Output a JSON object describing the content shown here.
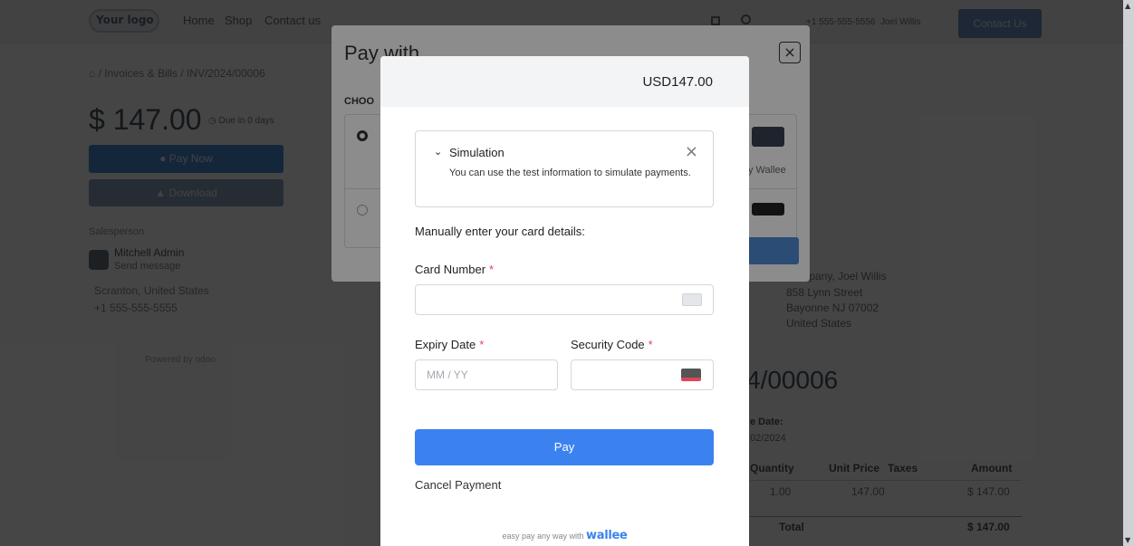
{
  "background": {
    "nav": {
      "logo_text": "Your logo",
      "links": [
        "Home",
        "Shop",
        "Contact us"
      ],
      "phone": "+1 555-555-5556",
      "user": "Joel Willis",
      "contact_button": "Contact Us"
    },
    "breadcrumb": "/ Invoices & Bills / INV/2024/00006",
    "amount": "$ 147.00",
    "due_badge": "Due in 0 days",
    "pay_now": "Pay Now",
    "download": "Download",
    "salesperson_label": "Salesperson",
    "salesperson_name": "Mitchell Admin",
    "send_message": "Send message",
    "location": "Scranton, United States",
    "phone": "+1 555-555-5555",
    "powered_by": "Powered by odoo",
    "address_lines": [
      "Company, Joel Willis",
      "858 Lynn Street",
      "Bayonne NJ 07002",
      "United States"
    ],
    "invoice_number_partial": "4/00006",
    "due_date_label": "e Date:",
    "due_date_value": "02/2024",
    "table_headers": [
      "Quantity",
      "Unit Price",
      "Taxes",
      "Amount"
    ],
    "row": {
      "quantity": "1.00",
      "unit_price": "147.00",
      "amount": "$ 147.00"
    },
    "total_label": "Total",
    "total_value": "$ 147.00"
  },
  "paywith": {
    "title": "Pay with",
    "close": "×",
    "choose_label": "CHOO",
    "wallee_caption": "y Wallee"
  },
  "wallee": {
    "header_amount": "USD147.00",
    "simulation": {
      "title": "Simulation",
      "text": "You can use the test information to simulate payments.",
      "close": "×"
    },
    "manual_label": "Manually enter your card details:",
    "card_number_label": "Card Number",
    "card_number_placeholder": "",
    "expiry_label": "Expiry Date",
    "expiry_placeholder": "MM / YY",
    "security_label": "Security Code",
    "security_placeholder": "",
    "required_mark": "*",
    "pay_button": "Pay",
    "cancel": "Cancel Payment",
    "footer_text": "easy pay any way with",
    "footer_brand": "wallee"
  },
  "colors": {
    "pay_blue": "#3b82f0",
    "required_red": "#e0455a",
    "overlay": "#000000"
  }
}
